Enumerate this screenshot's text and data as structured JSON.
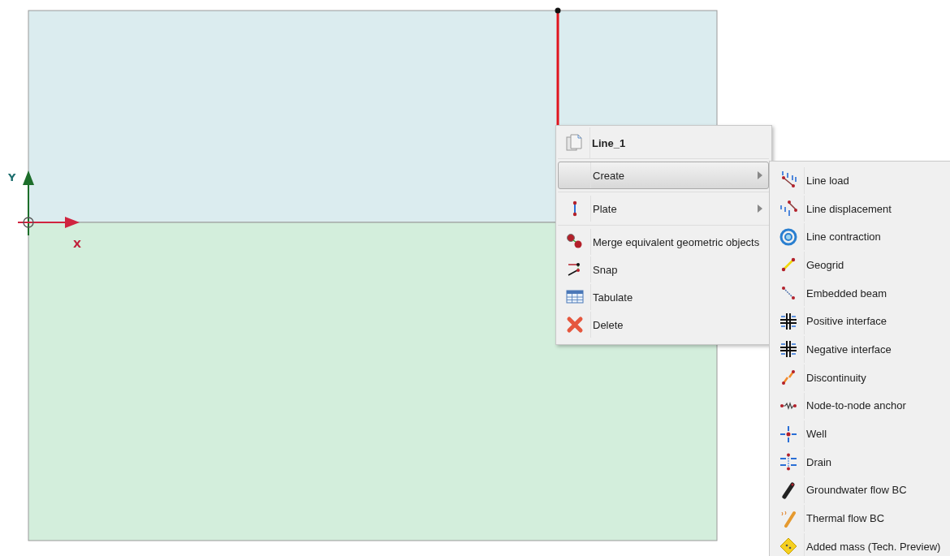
{
  "canvas": {
    "axis_labels": [
      {
        "kind": "y",
        "text": "Y"
      },
      {
        "kind": "x",
        "text": "X"
      }
    ],
    "selected_line": {
      "selected": true
    }
  },
  "context_menu": {
    "title": "Line_1",
    "groups": [
      [
        {
          "label": "Create",
          "selected": true,
          "submenu": true
        }
      ],
      [
        {
          "label": "Plate",
          "selected": false,
          "submenu": true
        }
      ],
      [
        {
          "label": "Merge equivalent geometric objects",
          "selected": false,
          "submenu": false
        },
        {
          "label": "Snap",
          "selected": false,
          "submenu": false
        },
        {
          "label": "Tabulate",
          "selected": false,
          "submenu": false
        },
        {
          "label": "Delete",
          "selected": false,
          "submenu": false
        }
      ]
    ]
  },
  "submenu": {
    "items": [
      {
        "label": "Line load"
      },
      {
        "label": "Line displacement"
      },
      {
        "label": "Line contraction"
      },
      {
        "label": "Geogrid"
      },
      {
        "label": "Embedded beam"
      },
      {
        "label": "Positive interface"
      },
      {
        "label": "Negative interface"
      },
      {
        "label": "Discontinuity"
      },
      {
        "label": "Node-to-node anchor"
      },
      {
        "label": "Well"
      },
      {
        "label": "Drain"
      },
      {
        "label": "Groundwater flow BC"
      },
      {
        "label": "Thermal flow BC"
      },
      {
        "label": "Added mass (Tech. Preview)"
      }
    ]
  }
}
